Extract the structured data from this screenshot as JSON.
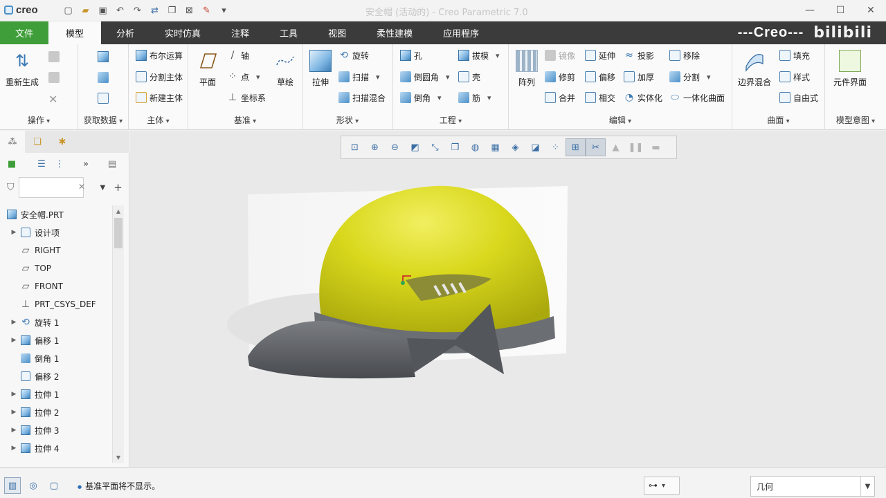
{
  "window": {
    "logo": "creo",
    "title": "安全帽 (活动的) - Creo Parametric 7.0"
  },
  "tabs": [
    {
      "label": "文件"
    },
    {
      "label": "模型"
    },
    {
      "label": "分析"
    },
    {
      "label": "实时仿真"
    },
    {
      "label": "注释"
    },
    {
      "label": "工具"
    },
    {
      "label": "视图"
    },
    {
      "label": "柔性建模"
    },
    {
      "label": "应用程序"
    }
  ],
  "brand": {
    "text": "---Creo---",
    "watermark": "bilibili"
  },
  "ribbon": {
    "operations": {
      "label": "操作",
      "regenerate": "重新生成"
    },
    "get_data": {
      "label": "获取数据"
    },
    "body": {
      "label": "主体",
      "boolean": "布尔运算",
      "split_body": "分割主体",
      "new_body": "新建主体"
    },
    "datum": {
      "label": "基准",
      "plane": "平面",
      "axis": "轴",
      "point": "点",
      "csys": "坐标系",
      "sketch": "草绘"
    },
    "shapes": {
      "label": "形状",
      "extrude": "拉伸",
      "revolve": "旋转",
      "sweep": "扫描",
      "swept_blend": "扫描混合"
    },
    "engineering": {
      "label": "工程",
      "hole": "孔",
      "round": "倒圆角",
      "chamfer": "倒角",
      "draft": "拔模",
      "shell": "壳",
      "rib": "筋"
    },
    "editing": {
      "label": "编辑",
      "pattern": "阵列",
      "mirror": "镜像",
      "trim": "修剪",
      "merge": "合并",
      "extend": "延伸",
      "offset": "偏移",
      "intersect": "相交",
      "project": "投影",
      "thicken": "加厚",
      "solidify": "实体化",
      "remove": "移除",
      "split": "分割",
      "unify": "一体化曲面"
    },
    "surfaces": {
      "label": "曲面",
      "boundary_blend": "边界混合",
      "fill": "填充",
      "style": "样式",
      "freestyle": "自由式"
    },
    "model_intent": {
      "label": "模型意图",
      "component_interface": "元件界面"
    }
  },
  "model_tree": {
    "nodes": [
      {
        "label": "安全帽.PRT",
        "expand": false
      },
      {
        "label": "设计项",
        "expand": true
      },
      {
        "label": "RIGHT",
        "expand": false
      },
      {
        "label": "TOP",
        "expand": false
      },
      {
        "label": "FRONT",
        "expand": false
      },
      {
        "label": "PRT_CSYS_DEF",
        "expand": false
      },
      {
        "label": "旋转 1",
        "expand": true
      },
      {
        "label": "偏移 1",
        "expand": true
      },
      {
        "label": "倒角 1",
        "expand": false
      },
      {
        "label": "偏移 2",
        "expand": false
      },
      {
        "label": "拉伸 1",
        "expand": true
      },
      {
        "label": "拉伸 2",
        "expand": true
      },
      {
        "label": "拉伸 3",
        "expand": true
      },
      {
        "label": "拉伸 4",
        "expand": true
      }
    ]
  },
  "status": {
    "message": "基准平面将不显示。",
    "selection_filter": "几何"
  },
  "colors": {
    "file_tab": "#3f9e3a",
    "tab_bar": "#3b3b3b",
    "helmet_yellow": "#d9d81d",
    "helmet_gray": "#5d6065"
  }
}
